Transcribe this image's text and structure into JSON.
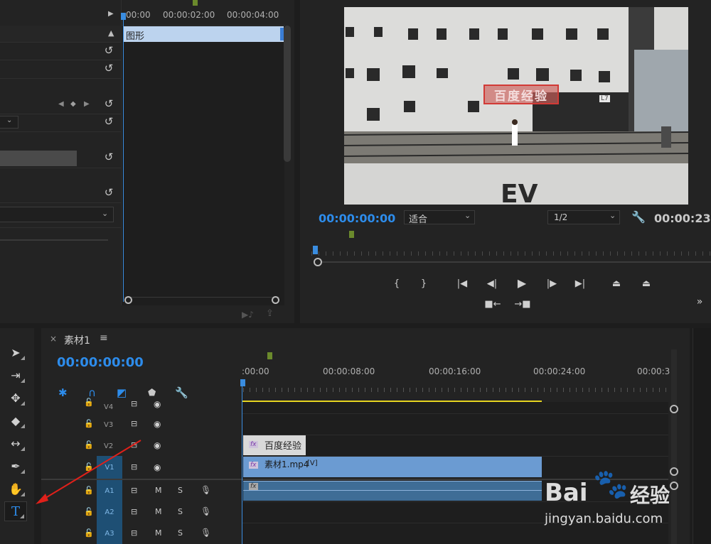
{
  "effect_controls": {
    "ruler_times": [
      "00:00",
      "00:00:02:00",
      "00:00:04:00"
    ],
    "clip_label": "图形"
  },
  "program_monitor": {
    "overlay_text": "百度经验",
    "sign_text": "L7",
    "current_time": "00:00:00:00",
    "fit_label": "适合",
    "resolution": "1/2",
    "duration": "00:00:23:"
  },
  "timeline": {
    "close_glyph": "×",
    "sequence_name": "素材1",
    "menu_glyph": "≡",
    "current_time": "00:00:00:00",
    "ruler_times": [
      ":00:00",
      "00:00:08:00",
      "00:00:16:00",
      "00:00:24:00",
      "00:00:3"
    ],
    "tracks": [
      {
        "name": "V4"
      },
      {
        "name": "V3"
      },
      {
        "name": "V2"
      },
      {
        "name": "V1"
      },
      {
        "name": "A1"
      },
      {
        "name": "A2"
      },
      {
        "name": "A3"
      }
    ],
    "mute_label": "M",
    "solo_label": "S",
    "clips": {
      "title_clip": "百度经验",
      "video_clip_name": "素材1.mp4",
      "video_clip_suffix": "[V]",
      "fx_badge": "fx"
    }
  },
  "watermark": {
    "brand": "Bai",
    "brand_suffix": "经验",
    "url": "jingyan.baidu.com"
  },
  "colors": {
    "accent_blue": "#2d8ceb",
    "clip_blue": "#6b9bd2",
    "playhead_blue": "#3a8de0",
    "marker_green": "#6b8a2c",
    "annotation_red": "#e0201a",
    "work_area_yellow": "#e6d520"
  }
}
